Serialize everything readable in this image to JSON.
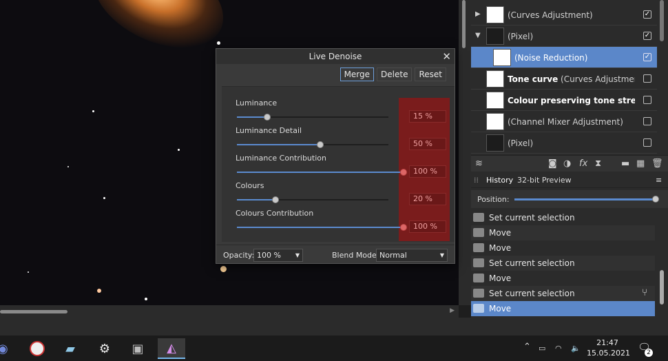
{
  "dialog": {
    "title": "Live Denoise",
    "close_glyph": "✕",
    "buttons": {
      "merge": "Merge",
      "delete": "Delete",
      "reset": "Reset"
    },
    "sliders": [
      {
        "label": "Luminance",
        "value": "15 %",
        "fraction": 0.18
      },
      {
        "label": "Luminance Detail",
        "value": "50 %",
        "fraction": 0.5
      },
      {
        "label": "Luminance Contribution",
        "value": "100 %",
        "fraction": 1.0
      },
      {
        "label": "Colours",
        "value": "20 %",
        "fraction": 0.23
      },
      {
        "label": "Colours Contribution",
        "value": "100 %",
        "fraction": 1.0
      }
    ],
    "footer": {
      "opacity_label": "Opacity:",
      "opacity_value": "100 %",
      "blend_label": "Blend Mode:",
      "blend_value": "Normal"
    }
  },
  "layers": [
    {
      "name": "(Curves Adjustment)",
      "bold": "",
      "checked": "✓",
      "expander": "▶"
    },
    {
      "name": "(Pixel)",
      "bold": "",
      "checked": "✓",
      "expander": "▼"
    },
    {
      "name": "(Noise Reduction)",
      "bold": "",
      "checked": "✓",
      "expander": ""
    },
    {
      "name": " (Curves Adjustment)",
      "bold": "Tone curve",
      "checked": "",
      "expander": ""
    },
    {
      "name": "",
      "bold": "Colour preserving tone stretch...",
      "checked": "",
      "expander": ""
    },
    {
      "name": "(Channel Mixer Adjustment)",
      "bold": "",
      "checked": "",
      "expander": ""
    },
    {
      "name": "(Pixel)",
      "bold": "",
      "checked": "",
      "expander": ""
    }
  ],
  "history_tabs": {
    "history": "History",
    "preview": "32-bit Preview",
    "menu": "≡"
  },
  "position_label": "Position:",
  "history": [
    "Set current selection",
    "Move",
    "Move",
    "Set current selection",
    "Move",
    "Set current selection",
    "Move"
  ],
  "taskbar": {
    "time": "21:47",
    "date": "15.05.2021",
    "notifications": "2"
  }
}
